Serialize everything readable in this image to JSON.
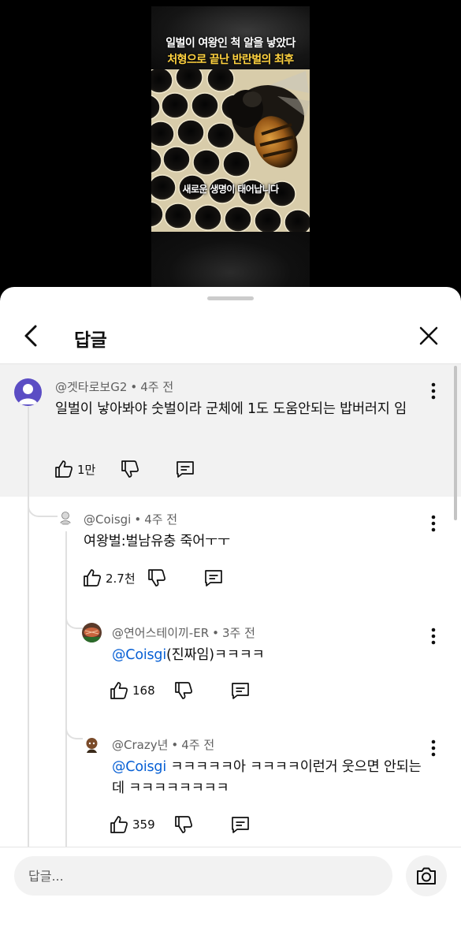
{
  "video": {
    "title_line1": "일벌이 여왕인 척 알을 낳았다",
    "title_line2": "처형으로 끝난 반란벌의 최후",
    "subtitle": "새로운 생명이 태어납니다"
  },
  "header": {
    "title": "답글",
    "back_icon": "chevron-left-icon",
    "close_icon": "close-icon"
  },
  "comments": [
    {
      "author": "@겟타로보G2",
      "time": "4주 전",
      "text": "일벌이 낳아봐야 숫벌이라 군체에 1도 도움안되는 밥버러지 임",
      "mention": "",
      "likes": "1만",
      "avatar_color": "#5b4dc4"
    },
    {
      "author": "@Coisgi",
      "time": "4주 전",
      "text": "여왕벌:벌남유충 죽어ㅜㅜ",
      "mention": "",
      "likes": "2.7천",
      "avatar_color": "#9a9a9a"
    },
    {
      "author": "@연어스테이끼-ER",
      "time": "3주 전",
      "text": "(진짜임)ㅋㅋㅋㅋ",
      "mention": "@Coisgi",
      "likes": "168",
      "avatar_color": "#b0553a"
    },
    {
      "author": "@Crazy년",
      "time": "4주 전",
      "text": " ㅋㅋㅋㅋㅋ아 ㅋㅋㅋㅋ이런거 웃으면 안되는데 ㅋㅋㅋㅋㅋㅋㅋㅋ",
      "mention": "@Coisgi",
      "likes": "359",
      "avatar_color": "#7a4b2a"
    }
  ],
  "input": {
    "placeholder": "답글...",
    "value": ""
  },
  "colors": {
    "mention": "#065fd4",
    "highlight_bg": "#f2f2f2",
    "video_title_accent": "#ffd23f"
  }
}
